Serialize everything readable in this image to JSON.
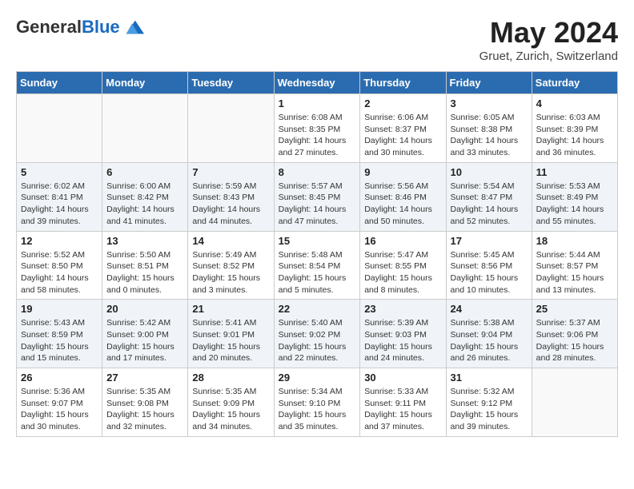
{
  "header": {
    "logo_line1": "General",
    "logo_line2": "Blue",
    "month": "May 2024",
    "location": "Gruet, Zurich, Switzerland"
  },
  "weekdays": [
    "Sunday",
    "Monday",
    "Tuesday",
    "Wednesday",
    "Thursday",
    "Friday",
    "Saturday"
  ],
  "weeks": [
    [
      {
        "day": "",
        "info": ""
      },
      {
        "day": "",
        "info": ""
      },
      {
        "day": "",
        "info": ""
      },
      {
        "day": "1",
        "info": "Sunrise: 6:08 AM\nSunset: 8:35 PM\nDaylight: 14 hours\nand 27 minutes."
      },
      {
        "day": "2",
        "info": "Sunrise: 6:06 AM\nSunset: 8:37 PM\nDaylight: 14 hours\nand 30 minutes."
      },
      {
        "day": "3",
        "info": "Sunrise: 6:05 AM\nSunset: 8:38 PM\nDaylight: 14 hours\nand 33 minutes."
      },
      {
        "day": "4",
        "info": "Sunrise: 6:03 AM\nSunset: 8:39 PM\nDaylight: 14 hours\nand 36 minutes."
      }
    ],
    [
      {
        "day": "5",
        "info": "Sunrise: 6:02 AM\nSunset: 8:41 PM\nDaylight: 14 hours\nand 39 minutes."
      },
      {
        "day": "6",
        "info": "Sunrise: 6:00 AM\nSunset: 8:42 PM\nDaylight: 14 hours\nand 41 minutes."
      },
      {
        "day": "7",
        "info": "Sunrise: 5:59 AM\nSunset: 8:43 PM\nDaylight: 14 hours\nand 44 minutes."
      },
      {
        "day": "8",
        "info": "Sunrise: 5:57 AM\nSunset: 8:45 PM\nDaylight: 14 hours\nand 47 minutes."
      },
      {
        "day": "9",
        "info": "Sunrise: 5:56 AM\nSunset: 8:46 PM\nDaylight: 14 hours\nand 50 minutes."
      },
      {
        "day": "10",
        "info": "Sunrise: 5:54 AM\nSunset: 8:47 PM\nDaylight: 14 hours\nand 52 minutes."
      },
      {
        "day": "11",
        "info": "Sunrise: 5:53 AM\nSunset: 8:49 PM\nDaylight: 14 hours\nand 55 minutes."
      }
    ],
    [
      {
        "day": "12",
        "info": "Sunrise: 5:52 AM\nSunset: 8:50 PM\nDaylight: 14 hours\nand 58 minutes."
      },
      {
        "day": "13",
        "info": "Sunrise: 5:50 AM\nSunset: 8:51 PM\nDaylight: 15 hours\nand 0 minutes."
      },
      {
        "day": "14",
        "info": "Sunrise: 5:49 AM\nSunset: 8:52 PM\nDaylight: 15 hours\nand 3 minutes."
      },
      {
        "day": "15",
        "info": "Sunrise: 5:48 AM\nSunset: 8:54 PM\nDaylight: 15 hours\nand 5 minutes."
      },
      {
        "day": "16",
        "info": "Sunrise: 5:47 AM\nSunset: 8:55 PM\nDaylight: 15 hours\nand 8 minutes."
      },
      {
        "day": "17",
        "info": "Sunrise: 5:45 AM\nSunset: 8:56 PM\nDaylight: 15 hours\nand 10 minutes."
      },
      {
        "day": "18",
        "info": "Sunrise: 5:44 AM\nSunset: 8:57 PM\nDaylight: 15 hours\nand 13 minutes."
      }
    ],
    [
      {
        "day": "19",
        "info": "Sunrise: 5:43 AM\nSunset: 8:59 PM\nDaylight: 15 hours\nand 15 minutes."
      },
      {
        "day": "20",
        "info": "Sunrise: 5:42 AM\nSunset: 9:00 PM\nDaylight: 15 hours\nand 17 minutes."
      },
      {
        "day": "21",
        "info": "Sunrise: 5:41 AM\nSunset: 9:01 PM\nDaylight: 15 hours\nand 20 minutes."
      },
      {
        "day": "22",
        "info": "Sunrise: 5:40 AM\nSunset: 9:02 PM\nDaylight: 15 hours\nand 22 minutes."
      },
      {
        "day": "23",
        "info": "Sunrise: 5:39 AM\nSunset: 9:03 PM\nDaylight: 15 hours\nand 24 minutes."
      },
      {
        "day": "24",
        "info": "Sunrise: 5:38 AM\nSunset: 9:04 PM\nDaylight: 15 hours\nand 26 minutes."
      },
      {
        "day": "25",
        "info": "Sunrise: 5:37 AM\nSunset: 9:06 PM\nDaylight: 15 hours\nand 28 minutes."
      }
    ],
    [
      {
        "day": "26",
        "info": "Sunrise: 5:36 AM\nSunset: 9:07 PM\nDaylight: 15 hours\nand 30 minutes."
      },
      {
        "day": "27",
        "info": "Sunrise: 5:35 AM\nSunset: 9:08 PM\nDaylight: 15 hours\nand 32 minutes."
      },
      {
        "day": "28",
        "info": "Sunrise: 5:35 AM\nSunset: 9:09 PM\nDaylight: 15 hours\nand 34 minutes."
      },
      {
        "day": "29",
        "info": "Sunrise: 5:34 AM\nSunset: 9:10 PM\nDaylight: 15 hours\nand 35 minutes."
      },
      {
        "day": "30",
        "info": "Sunrise: 5:33 AM\nSunset: 9:11 PM\nDaylight: 15 hours\nand 37 minutes."
      },
      {
        "day": "31",
        "info": "Sunrise: 5:32 AM\nSunset: 9:12 PM\nDaylight: 15 hours\nand 39 minutes."
      },
      {
        "day": "",
        "info": ""
      }
    ]
  ]
}
